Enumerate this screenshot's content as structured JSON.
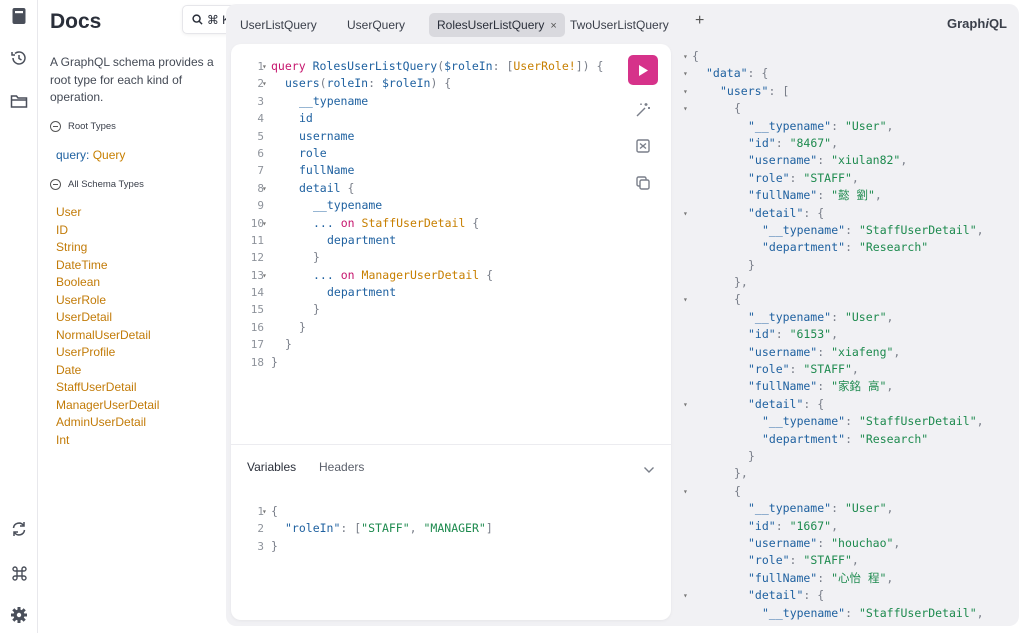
{
  "docs": {
    "title": "Docs",
    "search_shortcut": "⌘ K",
    "description": "A GraphQL schema provides a root type for each kind of operation.",
    "root_types_label": "Root Types",
    "root_query_keyword": "query",
    "root_query_type": "Query",
    "all_types_label": "All Schema Types",
    "types": [
      "User",
      "ID",
      "String",
      "DateTime",
      "Boolean",
      "UserRole",
      "UserDetail",
      "NormalUserDetail",
      "UserProfile",
      "Date",
      "StaffUserDetail",
      "ManagerUserDetail",
      "AdminUserDetail",
      "Int"
    ]
  },
  "tabs": [
    {
      "label": "UserListQuery",
      "active": false
    },
    {
      "label": "UserQuery",
      "active": false
    },
    {
      "label": "RolesUserListQuery",
      "active": true
    },
    {
      "label": "TwoUserListQuery",
      "active": false
    }
  ],
  "tab_close": "×",
  "tab_add": "+",
  "brand_pre": "Graph",
  "brand_i": "i",
  "brand_post": "QL",
  "editor": {
    "lines": [
      {
        "n": "1",
        "fold": true,
        "indent": 0,
        "tokens": [
          [
            "k",
            "query"
          ],
          [
            "pl",
            " "
          ],
          [
            "f",
            "RolesUserListQuery"
          ],
          [
            "p",
            "("
          ],
          [
            "v",
            "$roleIn"
          ],
          [
            "p",
            ": ["
          ],
          [
            "t",
            "UserRole!"
          ],
          [
            "p",
            "]) {"
          ]
        ]
      },
      {
        "n": "2",
        "fold": true,
        "indent": 1,
        "tokens": [
          [
            "f",
            "users"
          ],
          [
            "p",
            "("
          ],
          [
            "f",
            "roleIn"
          ],
          [
            "p",
            ": "
          ],
          [
            "v",
            "$roleIn"
          ],
          [
            "p",
            ") {"
          ]
        ]
      },
      {
        "n": "3",
        "fold": false,
        "indent": 2,
        "tokens": [
          [
            "f",
            "__typename"
          ]
        ]
      },
      {
        "n": "4",
        "fold": false,
        "indent": 2,
        "tokens": [
          [
            "f",
            "id"
          ]
        ]
      },
      {
        "n": "5",
        "fold": false,
        "indent": 2,
        "tokens": [
          [
            "f",
            "username"
          ]
        ]
      },
      {
        "n": "6",
        "fold": false,
        "indent": 2,
        "tokens": [
          [
            "f",
            "role"
          ]
        ]
      },
      {
        "n": "7",
        "fold": false,
        "indent": 2,
        "tokens": [
          [
            "f",
            "fullName"
          ]
        ]
      },
      {
        "n": "8",
        "fold": true,
        "indent": 2,
        "tokens": [
          [
            "f",
            "detail"
          ],
          [
            "p",
            " {"
          ]
        ]
      },
      {
        "n": "9",
        "fold": false,
        "indent": 3,
        "tokens": [
          [
            "f",
            "__typename"
          ]
        ]
      },
      {
        "n": "10",
        "fold": true,
        "indent": 3,
        "tokens": [
          [
            "f",
            "..."
          ],
          [
            "pl",
            " "
          ],
          [
            "k",
            "on"
          ],
          [
            "pl",
            " "
          ],
          [
            "t",
            "StaffUserDetail"
          ],
          [
            "p",
            " {"
          ]
        ]
      },
      {
        "n": "11",
        "fold": false,
        "indent": 4,
        "tokens": [
          [
            "f",
            "department"
          ]
        ]
      },
      {
        "n": "12",
        "fold": false,
        "indent": 3,
        "tokens": [
          [
            "p",
            "}"
          ]
        ]
      },
      {
        "n": "13",
        "fold": true,
        "indent": 3,
        "tokens": [
          [
            "f",
            "..."
          ],
          [
            "pl",
            " "
          ],
          [
            "k",
            "on"
          ],
          [
            "pl",
            " "
          ],
          [
            "t",
            "ManagerUserDetail"
          ],
          [
            "p",
            " {"
          ]
        ]
      },
      {
        "n": "14",
        "fold": false,
        "indent": 4,
        "tokens": [
          [
            "f",
            "department"
          ]
        ]
      },
      {
        "n": "15",
        "fold": false,
        "indent": 3,
        "tokens": [
          [
            "p",
            "}"
          ]
        ]
      },
      {
        "n": "16",
        "fold": false,
        "indent": 2,
        "tokens": [
          [
            "p",
            "}"
          ]
        ]
      },
      {
        "n": "17",
        "fold": false,
        "indent": 1,
        "tokens": [
          [
            "p",
            "}"
          ]
        ]
      },
      {
        "n": "18",
        "fold": false,
        "indent": 0,
        "tokens": [
          [
            "p",
            "}"
          ]
        ]
      }
    ]
  },
  "variables_tab": "Variables",
  "headers_tab": "Headers",
  "variables": {
    "lines": [
      {
        "n": "1",
        "fold": true,
        "indent": 0,
        "tokens": [
          [
            "p",
            "{"
          ]
        ]
      },
      {
        "n": "2",
        "fold": false,
        "indent": 1,
        "tokens": [
          [
            "f",
            "\"roleIn\""
          ],
          [
            "p",
            ": ["
          ],
          [
            "s",
            "\"STAFF\""
          ],
          [
            "p",
            ", "
          ],
          [
            "s",
            "\"MANAGER\""
          ],
          [
            "p",
            "]"
          ]
        ]
      },
      {
        "n": "3",
        "fold": false,
        "indent": 0,
        "tokens": [
          [
            "p",
            "}"
          ]
        ]
      }
    ]
  },
  "result": {
    "lines": [
      {
        "fold": true,
        "indent": 0,
        "tokens": [
          [
            "p",
            "{"
          ]
        ]
      },
      {
        "fold": true,
        "indent": 1,
        "tokens": [
          [
            "f",
            "\"data\""
          ],
          [
            "p",
            ": {"
          ]
        ]
      },
      {
        "fold": true,
        "indent": 2,
        "tokens": [
          [
            "f",
            "\"users\""
          ],
          [
            "p",
            ": ["
          ]
        ]
      },
      {
        "fold": true,
        "indent": 3,
        "tokens": [
          [
            "p",
            "{"
          ]
        ]
      },
      {
        "fold": false,
        "indent": 4,
        "tokens": [
          [
            "f",
            "\"__typename\""
          ],
          [
            "p",
            ": "
          ],
          [
            "s",
            "\"User\""
          ],
          [
            "p",
            ","
          ]
        ]
      },
      {
        "fold": false,
        "indent": 4,
        "tokens": [
          [
            "f",
            "\"id\""
          ],
          [
            "p",
            ": "
          ],
          [
            "s",
            "\"8467\""
          ],
          [
            "p",
            ","
          ]
        ]
      },
      {
        "fold": false,
        "indent": 4,
        "tokens": [
          [
            "f",
            "\"username\""
          ],
          [
            "p",
            ": "
          ],
          [
            "s",
            "\"xiulan82\""
          ],
          [
            "p",
            ","
          ]
        ]
      },
      {
        "fold": false,
        "indent": 4,
        "tokens": [
          [
            "f",
            "\"role\""
          ],
          [
            "p",
            ": "
          ],
          [
            "s",
            "\"STAFF\""
          ],
          [
            "p",
            ","
          ]
        ]
      },
      {
        "fold": false,
        "indent": 4,
        "tokens": [
          [
            "f",
            "\"fullName\""
          ],
          [
            "p",
            ": "
          ],
          [
            "s",
            "\"懿 劉\""
          ],
          [
            "p",
            ","
          ]
        ]
      },
      {
        "fold": true,
        "indent": 4,
        "tokens": [
          [
            "f",
            "\"detail\""
          ],
          [
            "p",
            ": {"
          ]
        ]
      },
      {
        "fold": false,
        "indent": 5,
        "tokens": [
          [
            "f",
            "\"__typename\""
          ],
          [
            "p",
            ": "
          ],
          [
            "s",
            "\"StaffUserDetail\""
          ],
          [
            "p",
            ","
          ]
        ]
      },
      {
        "fold": false,
        "indent": 5,
        "tokens": [
          [
            "f",
            "\"department\""
          ],
          [
            "p",
            ": "
          ],
          [
            "s",
            "\"Research\""
          ]
        ]
      },
      {
        "fold": false,
        "indent": 4,
        "tokens": [
          [
            "p",
            "}"
          ]
        ]
      },
      {
        "fold": false,
        "indent": 3,
        "tokens": [
          [
            "p",
            "},"
          ]
        ]
      },
      {
        "fold": true,
        "indent": 3,
        "tokens": [
          [
            "p",
            "{"
          ]
        ]
      },
      {
        "fold": false,
        "indent": 4,
        "tokens": [
          [
            "f",
            "\"__typename\""
          ],
          [
            "p",
            ": "
          ],
          [
            "s",
            "\"User\""
          ],
          [
            "p",
            ","
          ]
        ]
      },
      {
        "fold": false,
        "indent": 4,
        "tokens": [
          [
            "f",
            "\"id\""
          ],
          [
            "p",
            ": "
          ],
          [
            "s",
            "\"6153\""
          ],
          [
            "p",
            ","
          ]
        ]
      },
      {
        "fold": false,
        "indent": 4,
        "tokens": [
          [
            "f",
            "\"username\""
          ],
          [
            "p",
            ": "
          ],
          [
            "s",
            "\"xiafeng\""
          ],
          [
            "p",
            ","
          ]
        ]
      },
      {
        "fold": false,
        "indent": 4,
        "tokens": [
          [
            "f",
            "\"role\""
          ],
          [
            "p",
            ": "
          ],
          [
            "s",
            "\"STAFF\""
          ],
          [
            "p",
            ","
          ]
        ]
      },
      {
        "fold": false,
        "indent": 4,
        "tokens": [
          [
            "f",
            "\"fullName\""
          ],
          [
            "p",
            ": "
          ],
          [
            "s",
            "\"家銘 高\""
          ],
          [
            "p",
            ","
          ]
        ]
      },
      {
        "fold": true,
        "indent": 4,
        "tokens": [
          [
            "f",
            "\"detail\""
          ],
          [
            "p",
            ": {"
          ]
        ]
      },
      {
        "fold": false,
        "indent": 5,
        "tokens": [
          [
            "f",
            "\"__typename\""
          ],
          [
            "p",
            ": "
          ],
          [
            "s",
            "\"StaffUserDetail\""
          ],
          [
            "p",
            ","
          ]
        ]
      },
      {
        "fold": false,
        "indent": 5,
        "tokens": [
          [
            "f",
            "\"department\""
          ],
          [
            "p",
            ": "
          ],
          [
            "s",
            "\"Research\""
          ]
        ]
      },
      {
        "fold": false,
        "indent": 4,
        "tokens": [
          [
            "p",
            "}"
          ]
        ]
      },
      {
        "fold": false,
        "indent": 3,
        "tokens": [
          [
            "p",
            "},"
          ]
        ]
      },
      {
        "fold": true,
        "indent": 3,
        "tokens": [
          [
            "p",
            "{"
          ]
        ]
      },
      {
        "fold": false,
        "indent": 4,
        "tokens": [
          [
            "f",
            "\"__typename\""
          ],
          [
            "p",
            ": "
          ],
          [
            "s",
            "\"User\""
          ],
          [
            "p",
            ","
          ]
        ]
      },
      {
        "fold": false,
        "indent": 4,
        "tokens": [
          [
            "f",
            "\"id\""
          ],
          [
            "p",
            ": "
          ],
          [
            "s",
            "\"1667\""
          ],
          [
            "p",
            ","
          ]
        ]
      },
      {
        "fold": false,
        "indent": 4,
        "tokens": [
          [
            "f",
            "\"username\""
          ],
          [
            "p",
            ": "
          ],
          [
            "s",
            "\"houchao\""
          ],
          [
            "p",
            ","
          ]
        ]
      },
      {
        "fold": false,
        "indent": 4,
        "tokens": [
          [
            "f",
            "\"role\""
          ],
          [
            "p",
            ": "
          ],
          [
            "s",
            "\"STAFF\""
          ],
          [
            "p",
            ","
          ]
        ]
      },
      {
        "fold": false,
        "indent": 4,
        "tokens": [
          [
            "f",
            "\"fullName\""
          ],
          [
            "p",
            ": "
          ],
          [
            "s",
            "\"心怡 程\""
          ],
          [
            "p",
            ","
          ]
        ]
      },
      {
        "fold": true,
        "indent": 4,
        "tokens": [
          [
            "f",
            "\"detail\""
          ],
          [
            "p",
            ": {"
          ]
        ]
      },
      {
        "fold": false,
        "indent": 5,
        "tokens": [
          [
            "f",
            "\"__typename\""
          ],
          [
            "p",
            ": "
          ],
          [
            "s",
            "\"StaffUserDetail\""
          ],
          [
            "p",
            ","
          ]
        ]
      }
    ]
  },
  "icons": {
    "docs": "book-icon",
    "history": "history-icon",
    "explorer": "folder-icon",
    "refetch": "refresh-icon",
    "shortcuts": "command-icon",
    "settings": "gear-icon",
    "run": "play-icon",
    "prettify": "magic-wand-icon",
    "merge": "merge-fragments-icon",
    "copy": "copy-icon"
  },
  "colors": {
    "accent": "#d6328a",
    "keyword": "#c6166e",
    "field": "#1f61a0",
    "type": "#c77f00",
    "string": "#1d8a4e"
  }
}
